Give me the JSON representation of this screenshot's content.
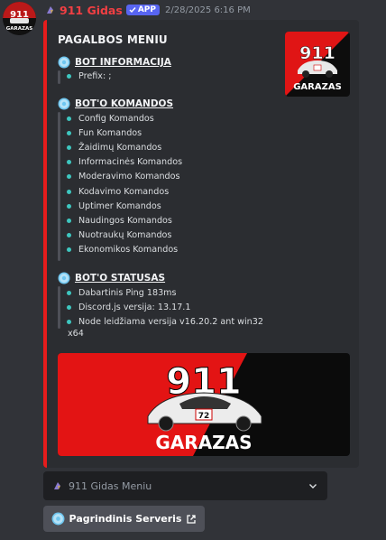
{
  "message": {
    "username": "911 Gidas",
    "badge": "APP",
    "timestamp": "2/28/2025 6:16 PM",
    "embed": {
      "accent_color": "#e61c1c",
      "title": "PAGALBOS MENIU",
      "thumbnail_logo": "911 GARAZAS",
      "sections": {
        "bot_info": {
          "name": "BOT INFORMACIJA",
          "items": [
            "Prefix:   ;"
          ]
        },
        "commands": {
          "name": "BOT'O KOMANDOS",
          "items": [
            "Config Komandos",
            "Fun Komandos",
            "Žaidimų Komandos",
            "Informacinės Komandos",
            "Moderavimo Komandos",
            "Kodavimo Komandos",
            "Uptimer Komandos",
            "Naudingos Komandos",
            "Nuotraukų Komandos",
            "Ekonomikos Komandos"
          ]
        },
        "status": {
          "name": "BOT'O STATUSAS",
          "items": [
            "Dabartinis Ping 183ms",
            "Discord.js versija: 13.17.1",
            "Node leidžiama versija v16.20.2 ant win32"
          ],
          "overflow_text": "x64"
        }
      },
      "image_logo": "911 GARAZAS"
    },
    "select_menu": {
      "placeholder": "911 Gidas Meniu",
      "icon": "bot-emoji-icon"
    },
    "link_button": {
      "label": "Pagrindinis Serveris",
      "icon": "gear-badge-icon"
    }
  }
}
